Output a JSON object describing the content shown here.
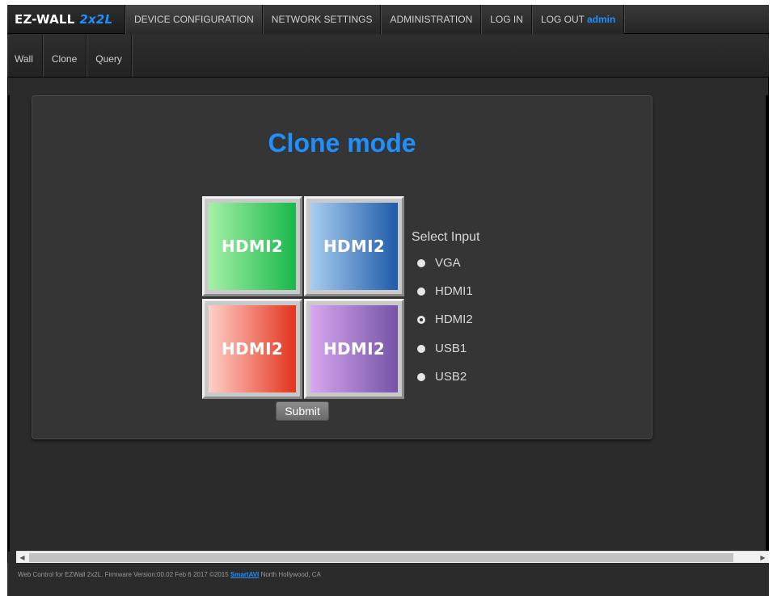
{
  "brand": {
    "name": "EZ-WALL",
    "model": "2x2L"
  },
  "nav": {
    "items": [
      "DEVICE CONFIGURATION",
      "NETWORK SETTINGS",
      "ADMINISTRATION",
      "LOG IN"
    ],
    "logout_label": "LOG OUT",
    "user": "admin"
  },
  "subnav": {
    "items": [
      "Wall",
      "Clone",
      "Query"
    ]
  },
  "main": {
    "title": "Clone mode",
    "tiles": [
      {
        "label": "HDMI2",
        "gradient": [
          "#a6f0a6",
          "#17b84a"
        ]
      },
      {
        "label": "HDMI2",
        "gradient": [
          "#a9cdf0",
          "#1f5ba8"
        ]
      },
      {
        "label": "HDMI2",
        "gradient": [
          "#ffd0c8",
          "#e3331e"
        ]
      },
      {
        "label": "HDMI2",
        "gradient": [
          "#d7a6f0",
          "#7554a6"
        ]
      }
    ],
    "select_label": "Select Input",
    "options": [
      "VGA",
      "HDMI1",
      "HDMI2",
      "USB1",
      "USB2"
    ],
    "selected": "HDMI2",
    "submit_label": "Submit"
  },
  "footer": {
    "text_before": "Web Control for EZWall 2x2L.   Firmware Version:00.02 Feb 6 2017   ©2015 ",
    "link": "SmartAVI",
    "text_after": " North Hollywood, CA"
  },
  "colors": {
    "accent": "#1e90ff",
    "background": "#2b2b2b"
  }
}
